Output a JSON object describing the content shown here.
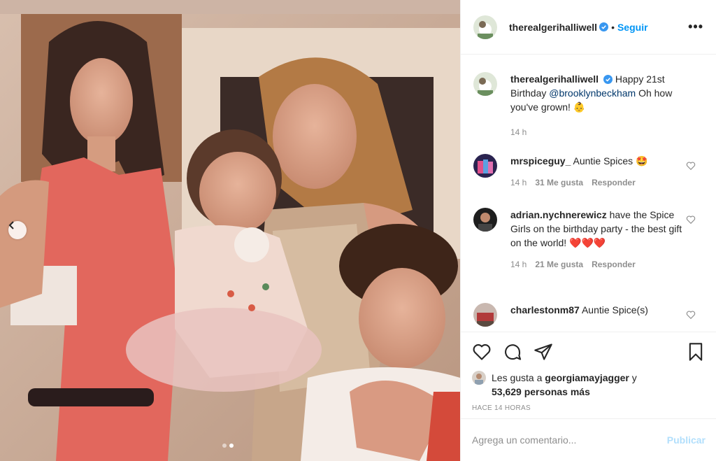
{
  "photo": {
    "alt_icon": "photo-collage",
    "dots_count": 2,
    "active_dot": 2
  },
  "header": {
    "username": "therealgerihalliwell",
    "separator": "•",
    "follow_label": "Seguir",
    "more_label": "•••"
  },
  "caption": {
    "username": "therealgerihalliwell",
    "text_before": "Happy 21st Birthday ",
    "mention": "@brooklynbeckham",
    "text_after": " Oh how you've grown! 👶",
    "time": "14 h"
  },
  "comments": [
    {
      "username": "mrspiceguy_",
      "text": "Auntie Spices 🤩",
      "time": "14 h",
      "likes": "31 Me gusta",
      "reply": "Responder"
    },
    {
      "username": "adrian.nychnerewicz",
      "text": "have the Spice Girls on the birthday party - the best gift on the world! ❤️❤️❤️",
      "time": "14 h",
      "likes": "21 Me gusta",
      "reply": "Responder"
    },
    {
      "username": "charlestonm87",
      "text": "Auntie Spice(s)"
    }
  ],
  "likes": {
    "prefix": "Les gusta a ",
    "user": "georgiamayjagger",
    "middle": " y",
    "count": "53,629 personas más"
  },
  "posted": "HACE 14 HORAS",
  "add_comment": {
    "placeholder": "Agrega un comentario...",
    "publish_label": "Publicar"
  },
  "colors": {
    "link": "#0095f6",
    "mention": "#00376b",
    "muted": "#8e8e8e",
    "publish_disabled": "#b2dffc",
    "verified": "#3897f0"
  }
}
